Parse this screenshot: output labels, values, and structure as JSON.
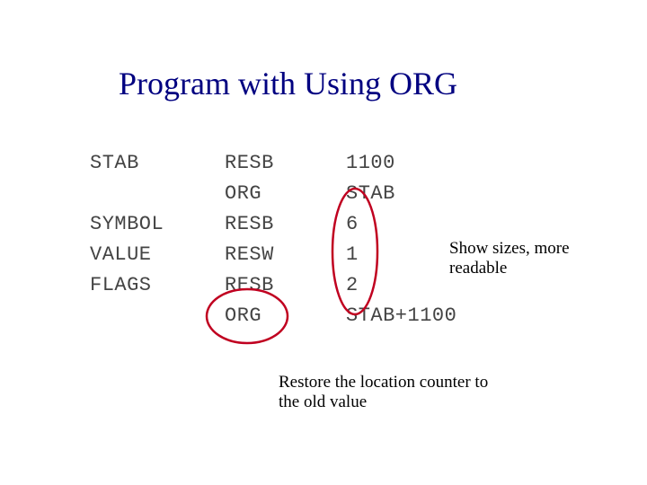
{
  "title": "Program with Using ORG",
  "code": {
    "rows": [
      {
        "label": "STAB",
        "op": "RESB",
        "arg": "1100"
      },
      {
        "label": "",
        "op": "ORG",
        "arg": "STAB"
      },
      {
        "label": "SYMBOL",
        "op": "RESB",
        "arg": "6"
      },
      {
        "label": "VALUE",
        "op": "RESW",
        "arg": "1"
      },
      {
        "label": "FLAGS",
        "op": "RESB",
        "arg": "2"
      },
      {
        "label": "",
        "op": "ORG",
        "arg": "STAB+1100"
      }
    ]
  },
  "annotations": {
    "sizes_line1": "Show sizes, more",
    "sizes_line2": "readable",
    "restore_line1": "Restore the location counter to",
    "restore_line2": "the old value"
  },
  "icons": {
    "oval_sizes": "annotation-oval",
    "oval_org": "annotation-oval"
  },
  "colors": {
    "title": "#000080",
    "oval": "#c00020"
  }
}
